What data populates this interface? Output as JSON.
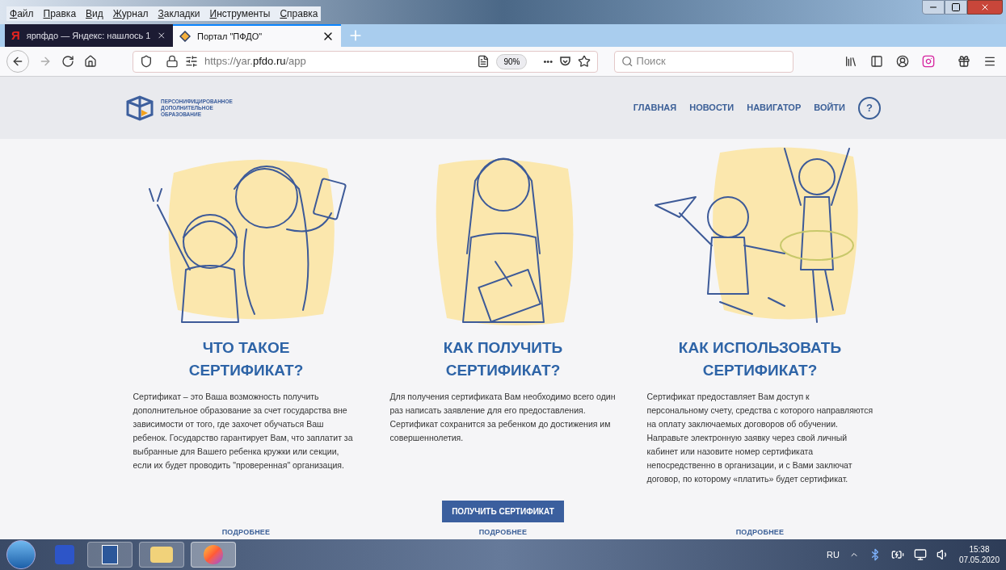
{
  "menu": [
    "Файл",
    "Правка",
    "Вид",
    "Журнал",
    "Закладки",
    "Инструменты",
    "Справка"
  ],
  "tabs": [
    {
      "title": "ярпфдо — Яндекс: нашлось 1",
      "selected": false,
      "kind": "yandex",
      "favicon": "Я"
    },
    {
      "title": "Портал \"ПФДО\"",
      "selected": true,
      "kind": "site"
    }
  ],
  "toolbar": {
    "url": {
      "start": "https://yar.",
      "domain": "pfdo.ru",
      "path": "/app"
    },
    "zoom": "90%",
    "more": "•••",
    "search_placeholder": "Поиск"
  },
  "site": {
    "logo_lines": [
      "ПЕРСОНИФИЦИРОВАННОЕ",
      "ДОПОЛНИТЕЛЬНОЕ",
      "ОБРАЗОВАНИЕ"
    ],
    "nav": [
      "ГЛАВНАЯ",
      "НОВОСТИ",
      "НАВИГАТОР",
      "ВОЙТИ"
    ],
    "help": "?"
  },
  "columns": [
    {
      "kind": "mother_child",
      "title_lines": [
        "ЧТО ТАКОЕ",
        "СЕРТИФИКАТ?"
      ],
      "text": "Сертификат – это Ваша возможность получить дополнительное образование за счет государства вне зависимости от того, где захочет обучаться Ваш ребенок. Государство гарантирует Вам, что заплатит за выбранные для Вашего ребенка кружки или секции, если их будет проводить \"проверенная\" организация.",
      "link": "ПОДРОБНЕЕ"
    },
    {
      "kind": "woman",
      "title_lines": [
        "КАК ПОЛУЧИТЬ",
        "СЕРТИФИКАТ?"
      ],
      "text": "Для получения сертификата Вам необходимо всего один раз написать заявление для его предоставления. Сертификат сохранится за ребенком до достижения им совершеннолетия.",
      "button": "ПОЛУЧИТЬ СЕРТИФИКАТ",
      "link": "ПОДРОБНЕЕ"
    },
    {
      "kind": "kids",
      "title_lines": [
        "КАК ИСПОЛЬЗОВАТЬ",
        "СЕРТИФИКАТ?"
      ],
      "text": "Сертификат предоставляет Вам доступ к персональному счету, средства с которого направляются на оплату заключаемых договоров об обучении. Направьте электронную заявку через свой личный кабинет или назовите номер сертификата непосредственно в организации, и с Вами заключат договор, по которому «платить» будет сертификат.",
      "link": "ПОДРОБНЕЕ"
    }
  ],
  "taskbar": {
    "lang": "RU",
    "time": "15:38",
    "date": "07.05.2020"
  }
}
